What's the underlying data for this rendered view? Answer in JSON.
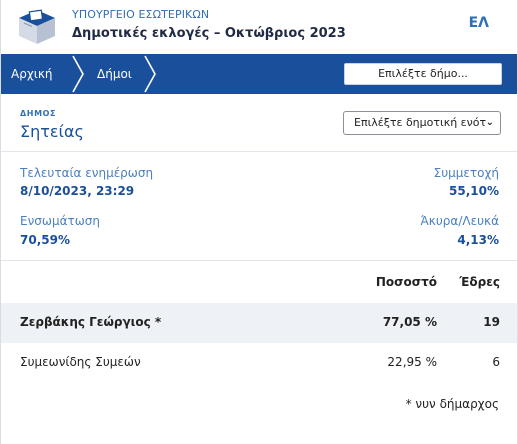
{
  "header": {
    "ministry": "ΥΠΟΥΡΓΕΙΟ ΕΣΩΤΕΡΙΚΩΝ",
    "election": "Δημοτικές εκλογές – Οκτώβριος 2023",
    "language": "ΕΛ"
  },
  "breadcrumb": {
    "home": "Αρχική",
    "dimoi": "Δήμοι",
    "select_button": "Επιλέξτε δήμο..."
  },
  "municipality": {
    "caption": "ΔΗΜΟΣ",
    "name": "Σητείας",
    "unit_select": "Επιλέξτε δημοτική ενότ"
  },
  "stats": {
    "last_update_label": "Τελευταία ενημέρωση",
    "last_update_value": "8/10/2023, 23:29",
    "participation_label": "Συμμετοχή",
    "participation_value": "55,10%",
    "integration_label": "Ενσωμάτωση",
    "integration_value": "70,59%",
    "invalid_label": "Άκυρα/Λευκά",
    "invalid_value": "4,13%"
  },
  "results": {
    "header_pct": "Ποσοστό",
    "header_seats": "Έδρες",
    "rows": [
      {
        "name": "Ζερβάκης Γεώργιος *",
        "pct": "77,05 %",
        "seats": "19"
      },
      {
        "name": "Συμεωνίδης Συμεών",
        "pct": "22,95 %",
        "seats": "6"
      }
    ],
    "footnote": "* νυν δήμαρχος"
  },
  "colors": {
    "primary": "#1a4f9c",
    "accent": "#2f6fb5",
    "label": "#4a7fc1",
    "winner_row": "#eef1f6"
  },
  "icons": {
    "logo": "ballot-box-icon",
    "breadcrumb_separator": "chevron-right-icon",
    "select_arrow": "chevron-down-icon"
  }
}
